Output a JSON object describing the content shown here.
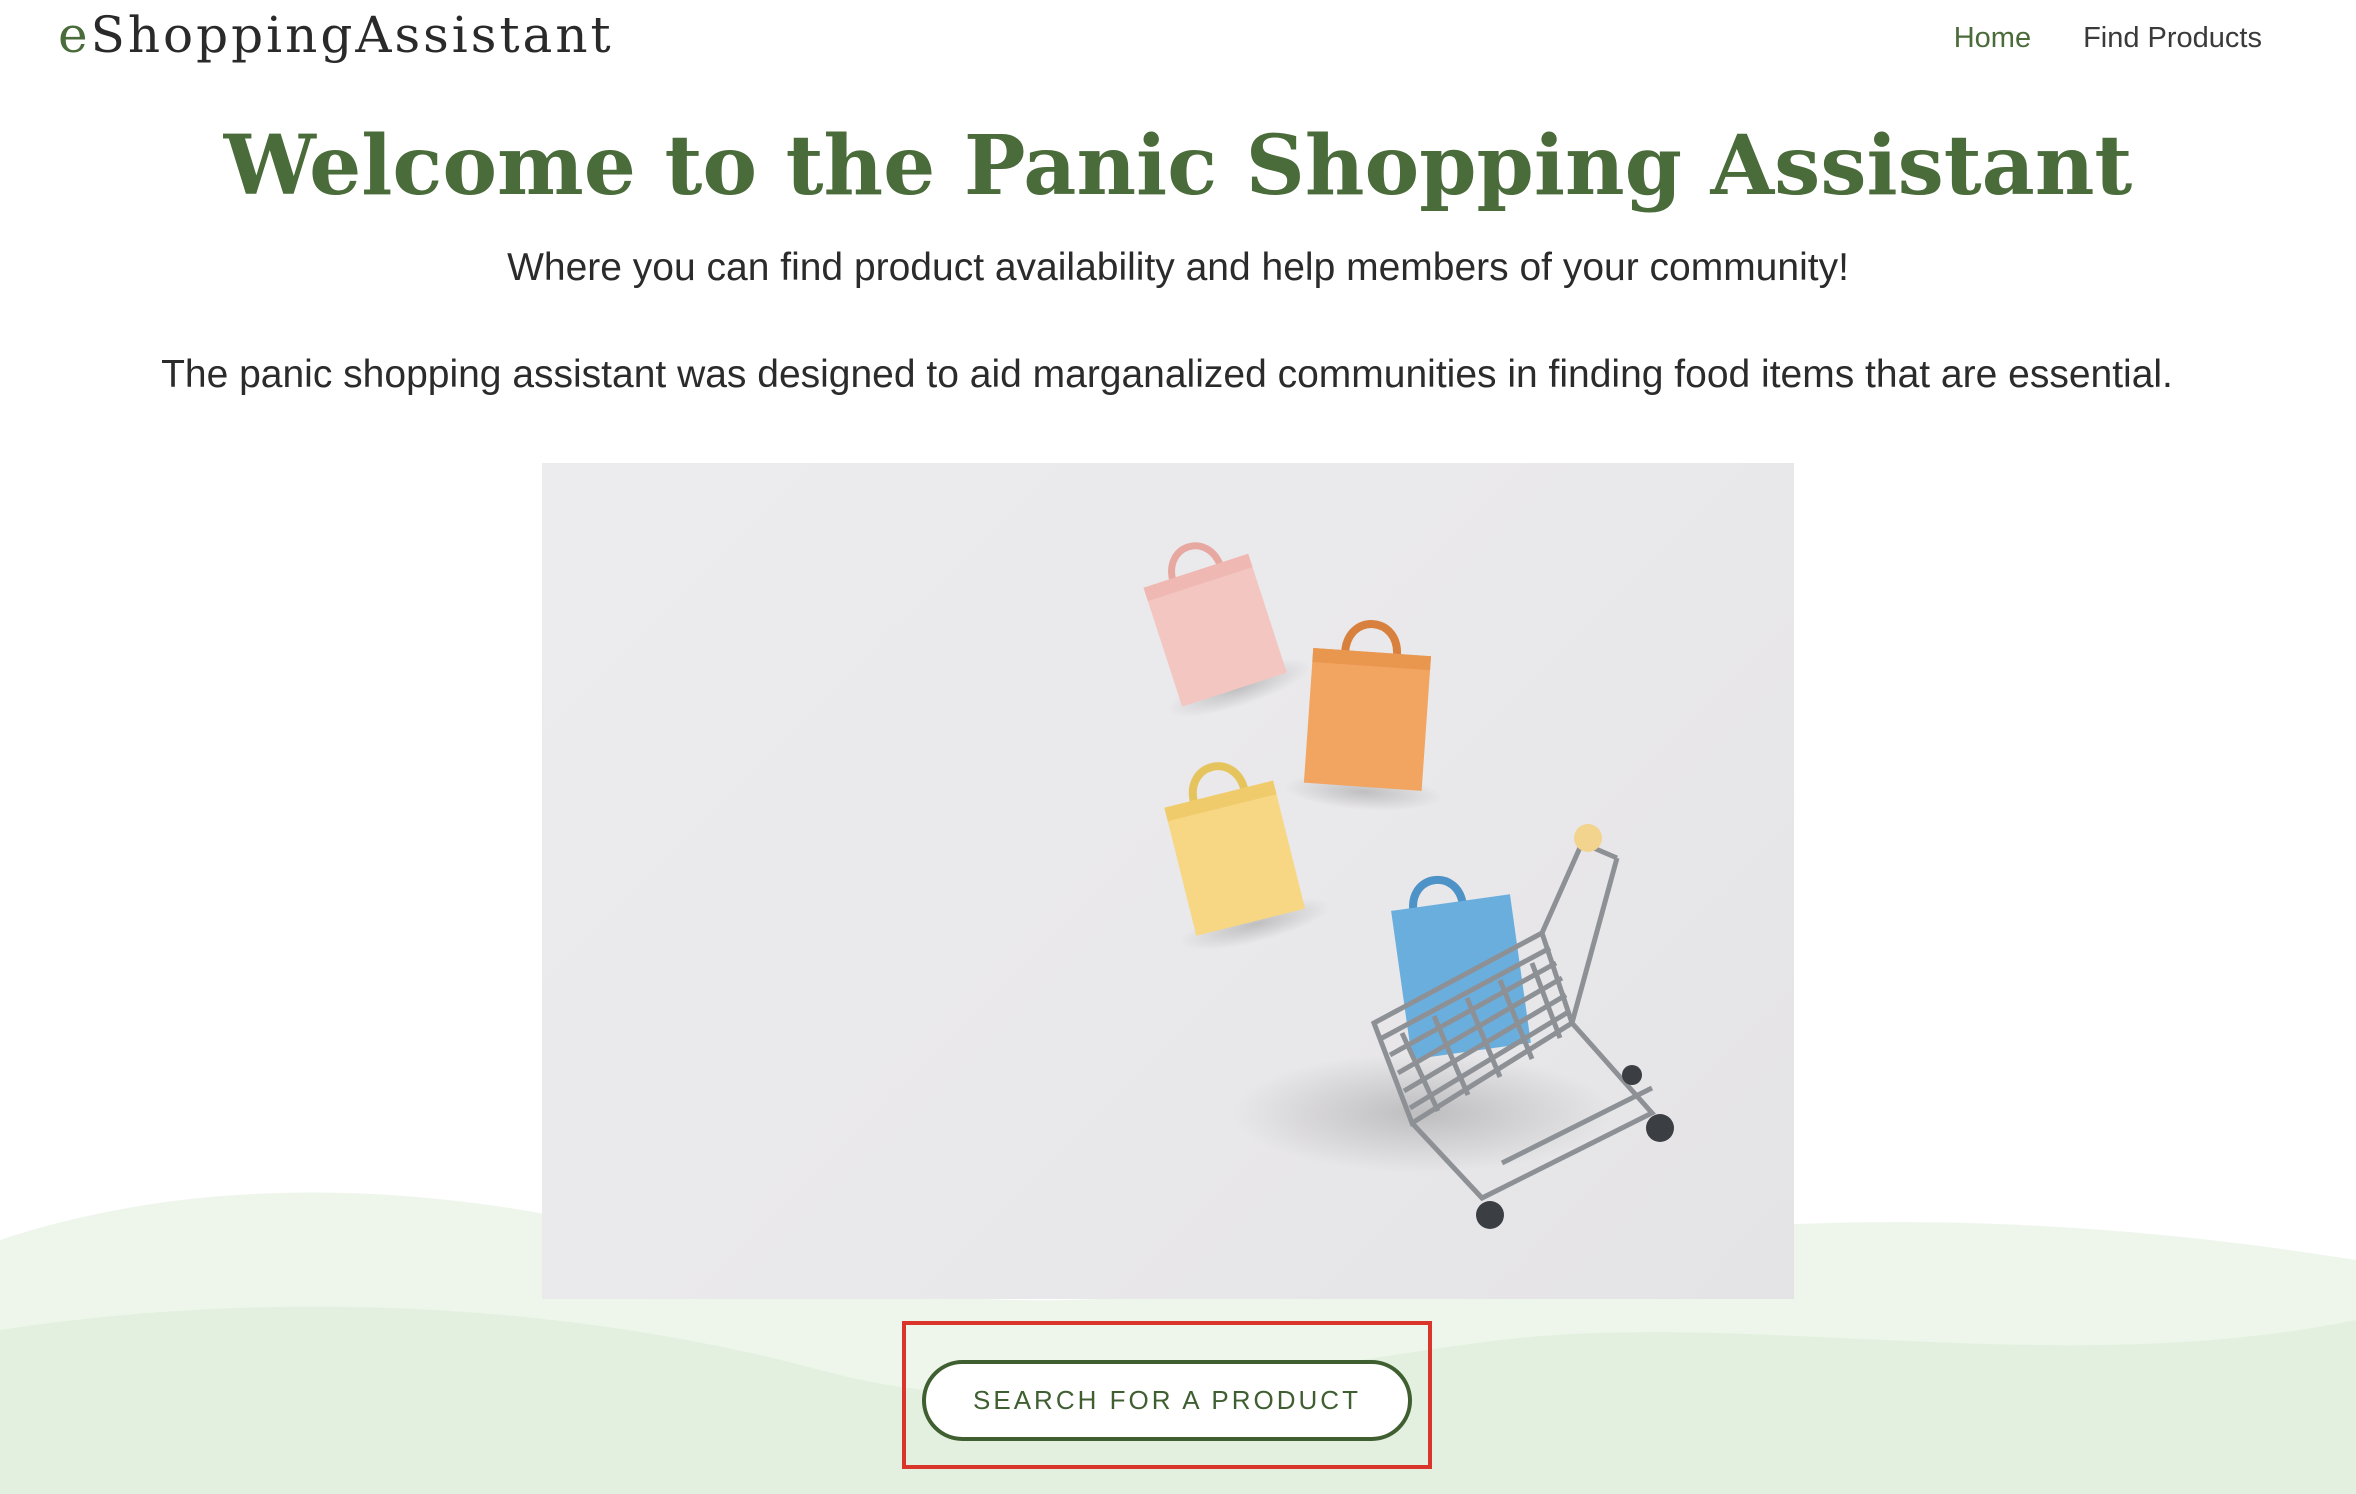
{
  "header": {
    "brand": {
      "first_letter": "e",
      "rest": "ShoppingAssistant"
    },
    "nav": [
      {
        "label": "Home",
        "active": true
      },
      {
        "label": "Find Products",
        "active": false
      }
    ]
  },
  "main": {
    "title": "Welcome to the Panic Shopping Assistant",
    "subtitle": "Where you can find product availability and help members of your community!",
    "description": "The panic shopping assistant was designed to aid marganalized communities in finding food items that are essential.",
    "cta_label": "SEARCH FOR A PRODUCT"
  },
  "colors": {
    "accent": "#4a6b3a",
    "button_border": "#3f5f31",
    "highlight_box": "#d9352b",
    "wave_light": "#eef6ec",
    "wave_mid": "#e3f0df"
  },
  "icons": {
    "hero_image": "shopping-bags-and-cart-photo"
  }
}
